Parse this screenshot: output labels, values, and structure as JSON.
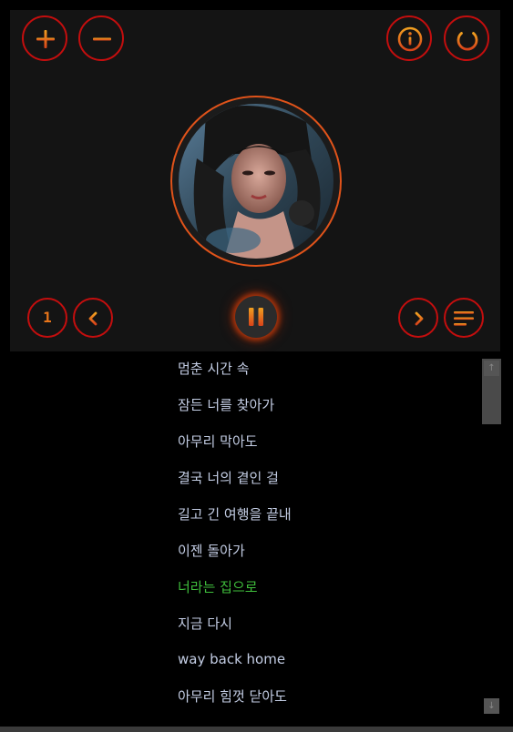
{
  "colors": {
    "button_ring": "#c40e0e",
    "icon_gradient_start": "#f0a020",
    "icon_gradient_end": "#d8431a",
    "panel_bg": "#141414",
    "lyric_text": "#c3cde4",
    "lyric_current": "#3fbe3c"
  },
  "controls": {
    "volume_up_icon": "plus-icon",
    "volume_down_icon": "minus-icon",
    "info_icon": "info-icon",
    "power_icon": "power-icon",
    "repeat_one_label": "1",
    "previous_icon": "chevron-left-icon",
    "pause_icon": "pause-icon",
    "next_icon": "chevron-right-icon",
    "playlist_icon": "list-icon"
  },
  "lyrics": {
    "lines": [
      "멈춘 시간 속",
      "잠든 너를 찾아가",
      "아무리 막아도",
      "결국 너의 곁인 걸",
      "길고 긴 여행을 끝내",
      "이젠 돌아가",
      "너라는 집으로",
      "지금 다시",
      "way back home",
      "아무리 힘껏 닫아도"
    ],
    "current_index": 6
  },
  "scrollbar": {
    "up_arrow": "↑",
    "down_arrow": "↓"
  }
}
